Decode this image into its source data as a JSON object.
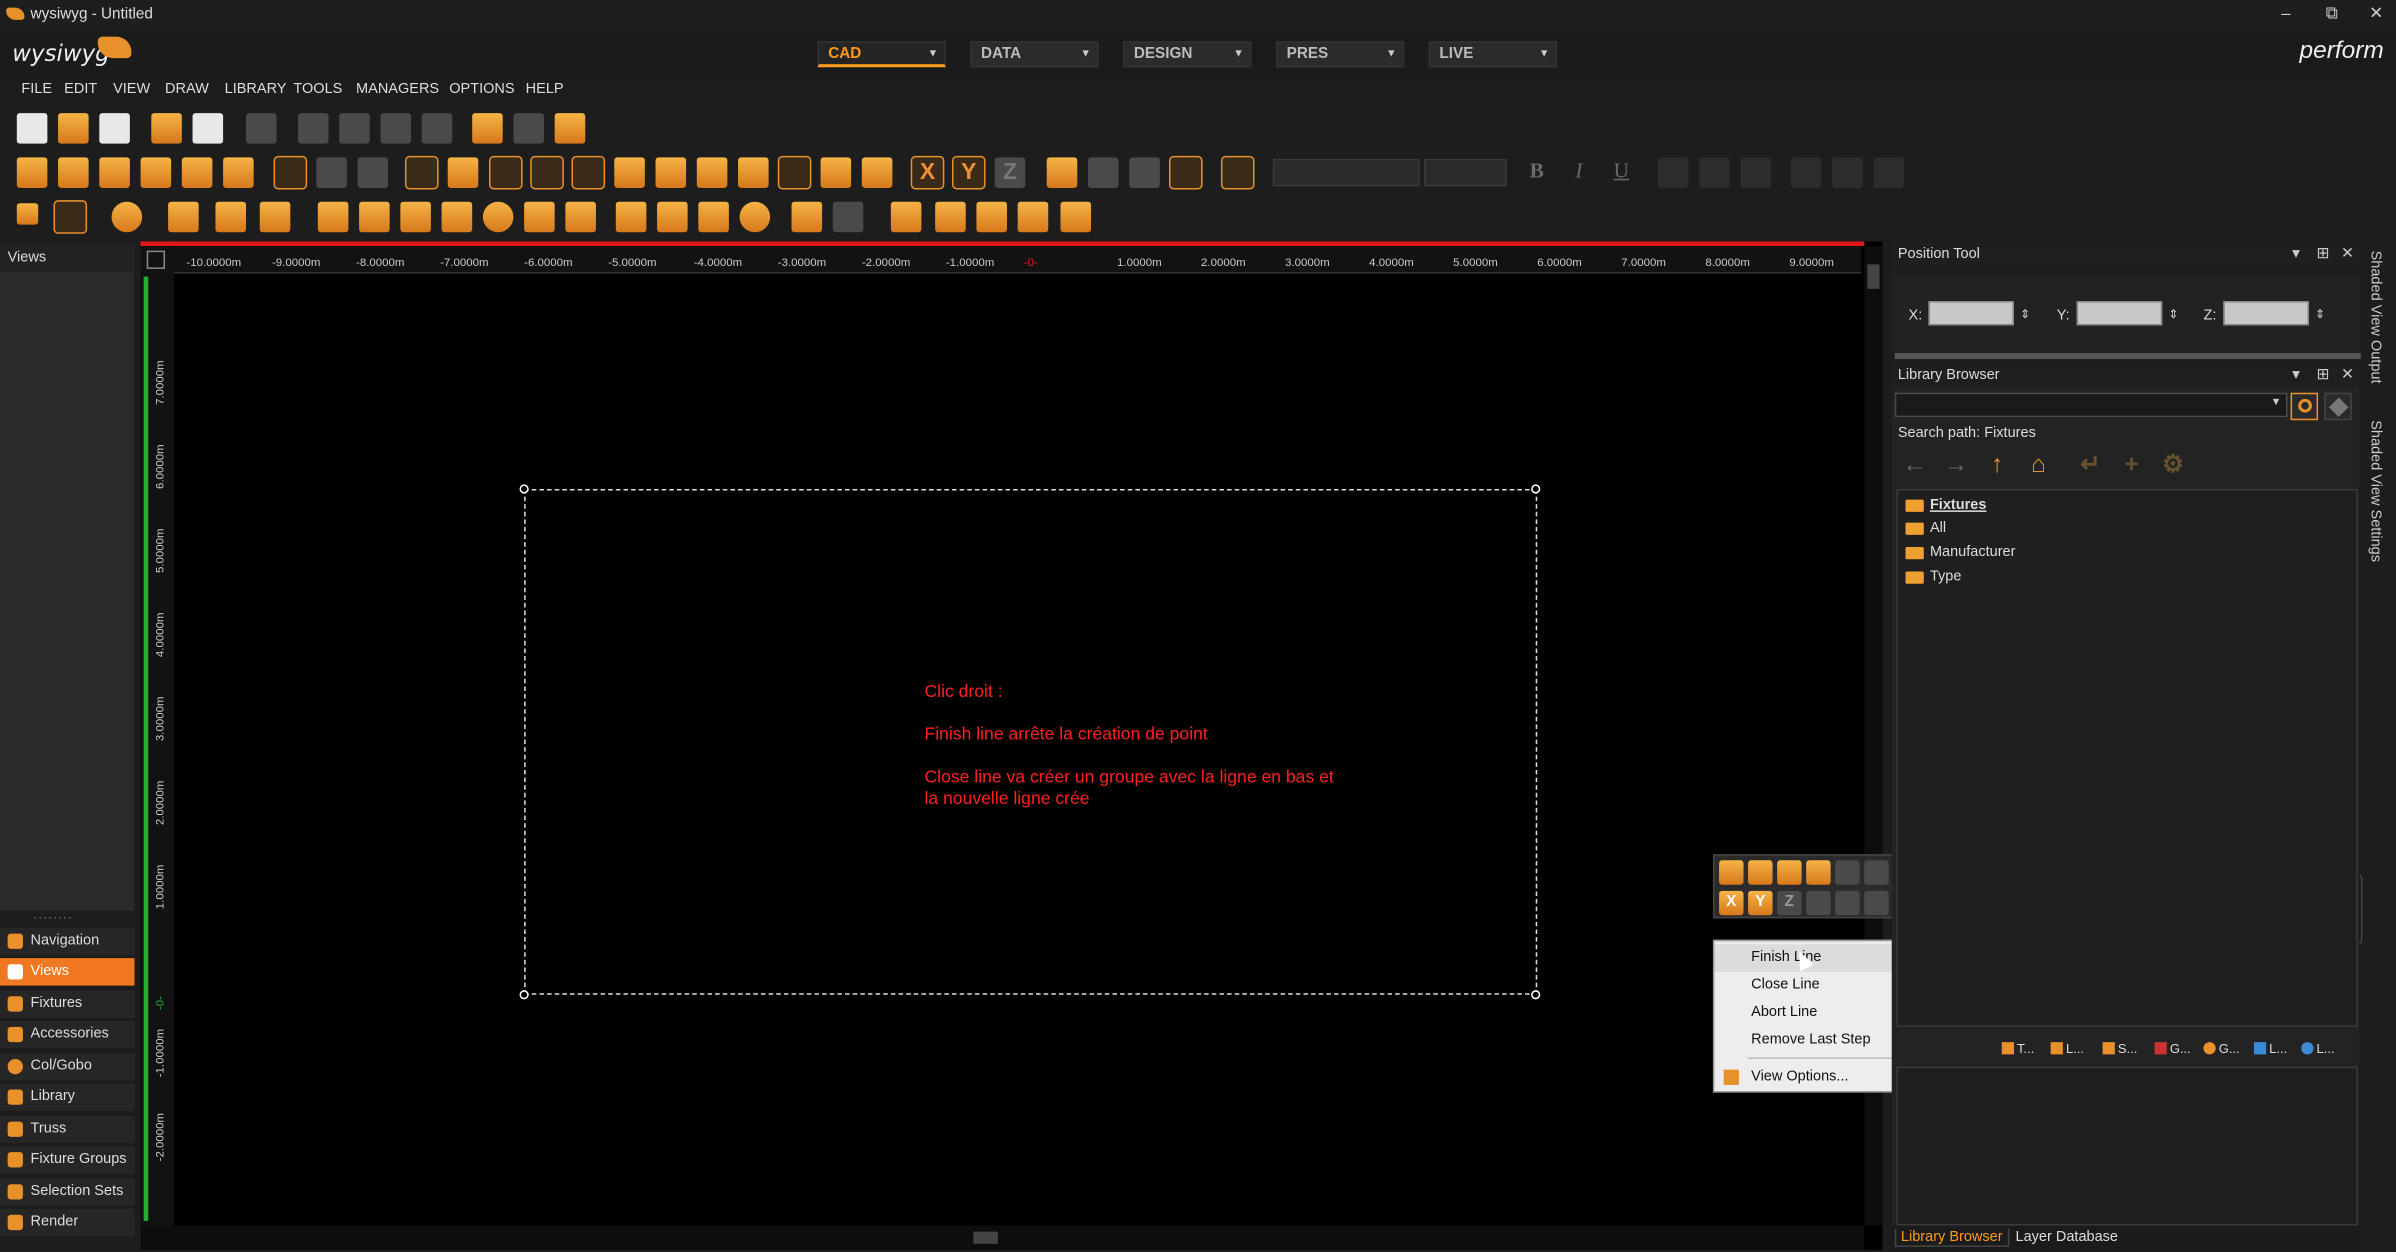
{
  "window": {
    "title": "wysiwyg - Untitled",
    "min": "–",
    "max": "⧉",
    "close": "✕"
  },
  "brand": {
    "name": "wysiwyg",
    "right_logo": "perform"
  },
  "modes": [
    {
      "label": "CAD",
      "active": true
    },
    {
      "label": "DATA",
      "active": false
    },
    {
      "label": "DESIGN",
      "active": false
    },
    {
      "label": "PRES",
      "active": false
    },
    {
      "label": "LIVE",
      "active": false
    }
  ],
  "menu": [
    "FILE",
    "EDIT",
    "VIEW",
    "DRAW",
    "LIBRARY",
    "TOOLS",
    "MANAGERS",
    "OPTIONS",
    "HELP"
  ],
  "toolbar": {
    "axis_x": "X",
    "axis_y": "Y",
    "axis_z": "Z",
    "bold": "B",
    "italic": "I",
    "underline": "U"
  },
  "left_panel": {
    "header": "Views",
    "grip": "........",
    "nav": [
      {
        "label": "Navigation",
        "active": false
      },
      {
        "label": "Views",
        "active": true
      },
      {
        "label": "Fixtures",
        "active": false
      },
      {
        "label": "Accessories",
        "active": false
      },
      {
        "label": "Col/Gobo",
        "active": false
      },
      {
        "label": "Library",
        "active": false
      },
      {
        "label": "Truss",
        "active": false
      },
      {
        "label": "Fixture Groups",
        "active": false
      },
      {
        "label": "Selection Sets",
        "active": false
      },
      {
        "label": "Render",
        "active": false
      }
    ]
  },
  "ruler": {
    "h_labels": [
      "-10.0000m",
      "-9.0000m",
      "-8.0000m",
      "-7.0000m",
      "-6.0000m",
      "-5.0000m",
      "-4.0000m",
      "-3.0000m",
      "-2.0000m",
      "-1.0000m",
      "-0-",
      "1.0000m",
      "2.0000m",
      "3.0000m",
      "4.0000m",
      "5.0000m",
      "6.0000m",
      "7.0000m",
      "8.0000m",
      "9.0000m"
    ],
    "v_labels": [
      "7.0000m",
      "6.0000m",
      "5.0000m",
      "4.0000m",
      "3.0000m",
      "2.0000m",
      "1.0000m",
      "-0-",
      "-1.0000m",
      "-2.0000m"
    ]
  },
  "annotation": {
    "line1": "Clic droit :",
    "line2": "Finish line arrête la création de point",
    "line3": "Close line va créer un groupe avec la ligne en bas et",
    "line4": "la nouvelle ligne crée"
  },
  "snap_toolbar": {
    "x": "X",
    "y": "Y",
    "z": "Z"
  },
  "context_menu": [
    {
      "label": "Finish Line",
      "key": "F"
    },
    {
      "label": "Close Line",
      "key": "C"
    },
    {
      "label": "Abort Line",
      "key": "A"
    },
    {
      "label": "Remove Last Step",
      "key": "R"
    },
    {
      "label": "View Options...",
      "key": ""
    }
  ],
  "position_tool": {
    "title": "Position Tool",
    "x_label": "X:",
    "y_label": "Y:",
    "z_label": "Z:"
  },
  "library_browser": {
    "title": "Library Browser",
    "search_path": "Search path: Fixtures",
    "tree": [
      {
        "label": "Fixtures",
        "bold": true
      },
      {
        "label": "All"
      },
      {
        "label": "Manufacturer"
      },
      {
        "label": "Type"
      }
    ],
    "lower_tabs": [
      "T...",
      "L...",
      "S...",
      "G...",
      "G...",
      "L...",
      "L..."
    ]
  },
  "bottom_tabs": [
    {
      "label": "Library Browser",
      "active": true
    },
    {
      "label": "Layer Database",
      "active": false
    }
  ],
  "side_tabs": [
    "Shaded View Output",
    "Shaded View Settings"
  ],
  "colors": {
    "accent": "#f07820",
    "annotation": "#ff2020",
    "ruler_red": "#e01818",
    "ruler_green": "#1fb030"
  }
}
